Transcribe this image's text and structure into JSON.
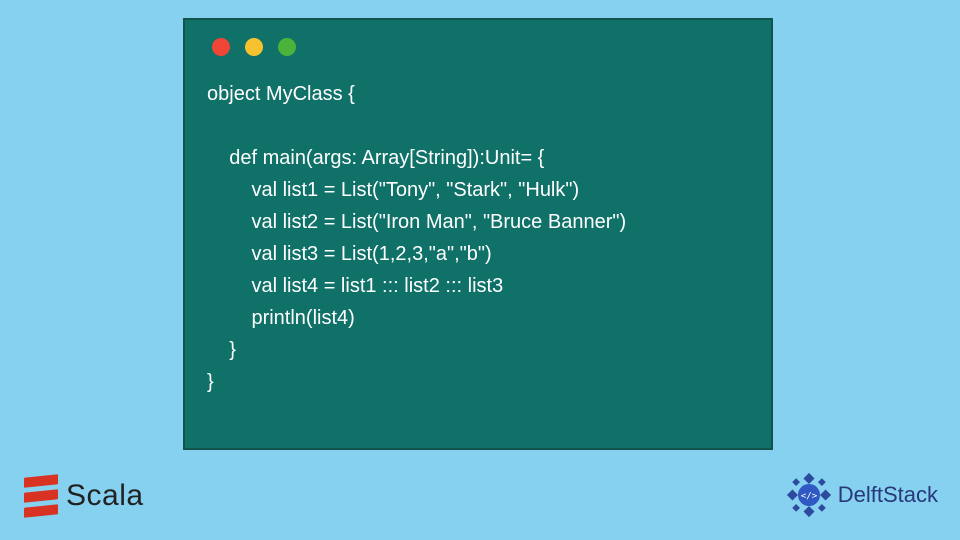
{
  "code": {
    "line1": "object MyClass {",
    "blank": "",
    "line2": "    def main(args: Array[String]):Unit= {",
    "line3": "        val list1 = List(\"Tony\", \"Stark\", \"Hulk\")",
    "line4": "        val list2 = List(\"Iron Man\", \"Bruce Banner\")",
    "line5": "        val list3 = List(1,2,3,\"a\",\"b\")",
    "line6": "        val list4 = list1 ::: list2 ::: list3",
    "line7": "        println(list4)",
    "line8": "    }",
    "line9": "}"
  },
  "brand": {
    "scala": "Scala",
    "delft": "DelftStack"
  },
  "colors": {
    "background": "#86d1f0",
    "panel": "#0f7168",
    "red": "#ef4637",
    "yellow": "#f7c22f",
    "green": "#4bb33b",
    "scalaRed": "#d73222",
    "delftBlue": "#28397a"
  }
}
